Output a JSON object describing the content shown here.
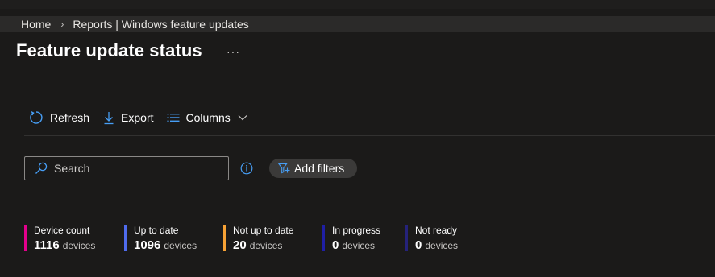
{
  "breadcrumb": {
    "items": [
      "Home",
      "Reports | Windows feature updates"
    ],
    "separator": "›"
  },
  "page": {
    "title": "Feature update status",
    "more_label": "···"
  },
  "toolbar": {
    "refresh_label": "Refresh",
    "export_label": "Export",
    "columns_label": "Columns"
  },
  "search": {
    "placeholder": "Search",
    "value": ""
  },
  "filters": {
    "add_label": "Add filters"
  },
  "stats": [
    {
      "label": "Device count",
      "value": "1116",
      "unit": "devices",
      "color": "#e3008c"
    },
    {
      "label": "Up to date",
      "value": "1096",
      "unit": "devices",
      "color": "#4f6bed"
    },
    {
      "label": "Not up to date",
      "value": "20",
      "unit": "devices",
      "color": "#f7a235"
    },
    {
      "label": "In progress",
      "value": "0",
      "unit": "devices",
      "color": "#1f1fa5"
    },
    {
      "label": "Not ready",
      "value": "0",
      "unit": "devices",
      "color": "#25227a"
    }
  ],
  "colors": {
    "background": "#1b1a19",
    "accent": "#479ef5"
  }
}
